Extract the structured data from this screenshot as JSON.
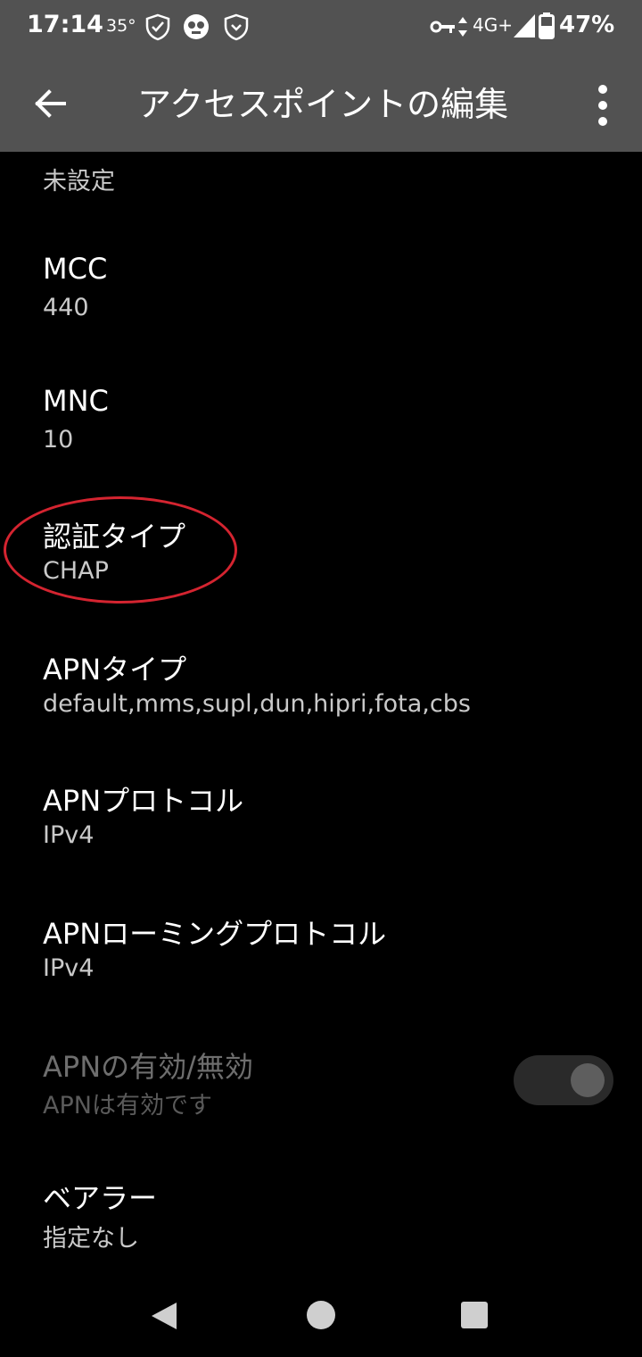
{
  "status_bar": {
    "time": "17:14",
    "temperature": "35°",
    "network": "4G+",
    "battery": "47%",
    "icons": [
      "shield-check-icon",
      "face-icon",
      "shield-icon",
      "vpn-key-icon",
      "data-arrows-icon",
      "signal-icon",
      "battery-icon"
    ]
  },
  "toolbar": {
    "title": "アクセスポイントの編集",
    "back_icon": "arrow-back-icon",
    "more_icon": "more-vert-icon"
  },
  "settings": {
    "partial_summary": "未設定",
    "mcc": {
      "title": "MCC",
      "value": "440"
    },
    "mnc": {
      "title": "MNC",
      "value": "10"
    },
    "auth_type": {
      "title": "認証タイプ",
      "value": "CHAP"
    },
    "apn_type": {
      "title": "APNタイプ",
      "value": "default,mms,supl,dun,hipri,fota,cbs"
    },
    "apn_protocol": {
      "title": "APNプロトコル",
      "value": "IPv4"
    },
    "apn_roaming_protocol": {
      "title": "APNローミングプロトコル",
      "value": "IPv4"
    },
    "apn_enable": {
      "title": "APNの有効/無効",
      "value": "APNは有効です",
      "enabled": true
    },
    "bearer": {
      "title": "ベアラー",
      "value": "指定なし"
    }
  },
  "annotation": {
    "color": "#d42430"
  },
  "nav_bar": {
    "icons": [
      "nav-back-icon",
      "nav-home-icon",
      "nav-recents-icon"
    ]
  }
}
